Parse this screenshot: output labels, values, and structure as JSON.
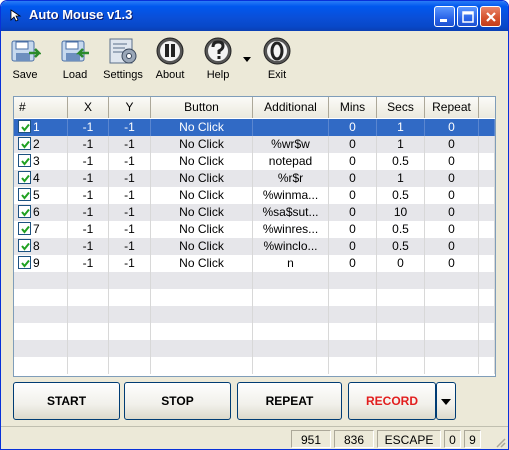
{
  "window": {
    "title": "Auto Mouse v1.3"
  },
  "toolbar": {
    "items": [
      {
        "label": "Save",
        "icon": "save-icon"
      },
      {
        "label": "Load",
        "icon": "load-icon"
      },
      {
        "label": "Settings",
        "icon": "settings-icon"
      },
      {
        "label": "About",
        "icon": "about-icon"
      },
      {
        "label": "Help",
        "icon": "help-icon"
      },
      {
        "label": "Exit",
        "icon": "exit-icon"
      }
    ]
  },
  "table": {
    "columns": [
      "#",
      "X",
      "Y",
      "Button",
      "Additional",
      "Mins",
      "Secs",
      "Repeat"
    ],
    "rows": [
      {
        "num": "1",
        "checked": true,
        "x": "-1",
        "y": "-1",
        "button": "No Click",
        "additional": "",
        "mins": "0",
        "secs": "1",
        "repeat": "0",
        "selected": true
      },
      {
        "num": "2",
        "checked": true,
        "x": "-1",
        "y": "-1",
        "button": "No Click",
        "additional": "%wr$w",
        "mins": "0",
        "secs": "1",
        "repeat": "0",
        "selected": false
      },
      {
        "num": "3",
        "checked": true,
        "x": "-1",
        "y": "-1",
        "button": "No Click",
        "additional": "notepad",
        "mins": "0",
        "secs": "0.5",
        "repeat": "0",
        "selected": false
      },
      {
        "num": "4",
        "checked": true,
        "x": "-1",
        "y": "-1",
        "button": "No Click",
        "additional": "%r$r",
        "mins": "0",
        "secs": "1",
        "repeat": "0",
        "selected": false
      },
      {
        "num": "5",
        "checked": true,
        "x": "-1",
        "y": "-1",
        "button": "No Click",
        "additional": "%winma...",
        "mins": "0",
        "secs": "0.5",
        "repeat": "0",
        "selected": false
      },
      {
        "num": "6",
        "checked": true,
        "x": "-1",
        "y": "-1",
        "button": "No Click",
        "additional": "%sa$sut...",
        "mins": "0",
        "secs": "10",
        "repeat": "0",
        "selected": false
      },
      {
        "num": "7",
        "checked": true,
        "x": "-1",
        "y": "-1",
        "button": "No Click",
        "additional": "%winres...",
        "mins": "0",
        "secs": "0.5",
        "repeat": "0",
        "selected": false
      },
      {
        "num": "8",
        "checked": true,
        "x": "-1",
        "y": "-1",
        "button": "No Click",
        "additional": "%winclo...",
        "mins": "0",
        "secs": "0.5",
        "repeat": "0",
        "selected": false
      },
      {
        "num": "9",
        "checked": true,
        "x": "-1",
        "y": "-1",
        "button": "No Click",
        "additional": "n",
        "mins": "0",
        "secs": "0",
        "repeat": "0",
        "selected": false
      }
    ]
  },
  "buttons": {
    "start": "START",
    "stop": "STOP",
    "repeat": "REPEAT",
    "record": "RECORD"
  },
  "statusbar": {
    "x": "951",
    "y": "836",
    "key": "ESCAPE",
    "a": "0",
    "b": "9"
  },
  "colors": {
    "selection": "#316ac5",
    "record_text": "#e21e1e",
    "titlebar": "#0a4fd8"
  }
}
